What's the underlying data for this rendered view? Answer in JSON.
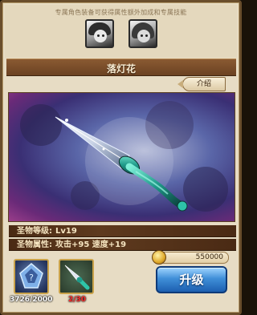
{
  "header": {
    "hint": "专属角色装备可获得属性额外加成和专属技能",
    "characters": [
      {
        "icon": "character-portrait-1"
      },
      {
        "icon": "character-portrait-2"
      }
    ]
  },
  "item": {
    "name": "落灯花",
    "intro_label": "介绍"
  },
  "stats": {
    "level_label": "圣物等级:",
    "level_value": "Lv19",
    "attr_label": "圣物属性:",
    "attr_value": "攻击+95 速度+19"
  },
  "materials": [
    {
      "icon": "crystal-icon",
      "count": "3726/2000",
      "color": "#ffffff"
    },
    {
      "icon": "dagger-icon",
      "count": "2/30",
      "color": "#ff2a2a"
    }
  ],
  "cost": {
    "gold": "550000",
    "icon": "gold-coin-icon"
  },
  "actions": {
    "upgrade_label": "升级"
  },
  "colors": {
    "frame": "#6a4e2c",
    "title_bar": "#6b4222",
    "upgrade_button": "#3f8fd8",
    "stat_row": "#4a2a14"
  }
}
